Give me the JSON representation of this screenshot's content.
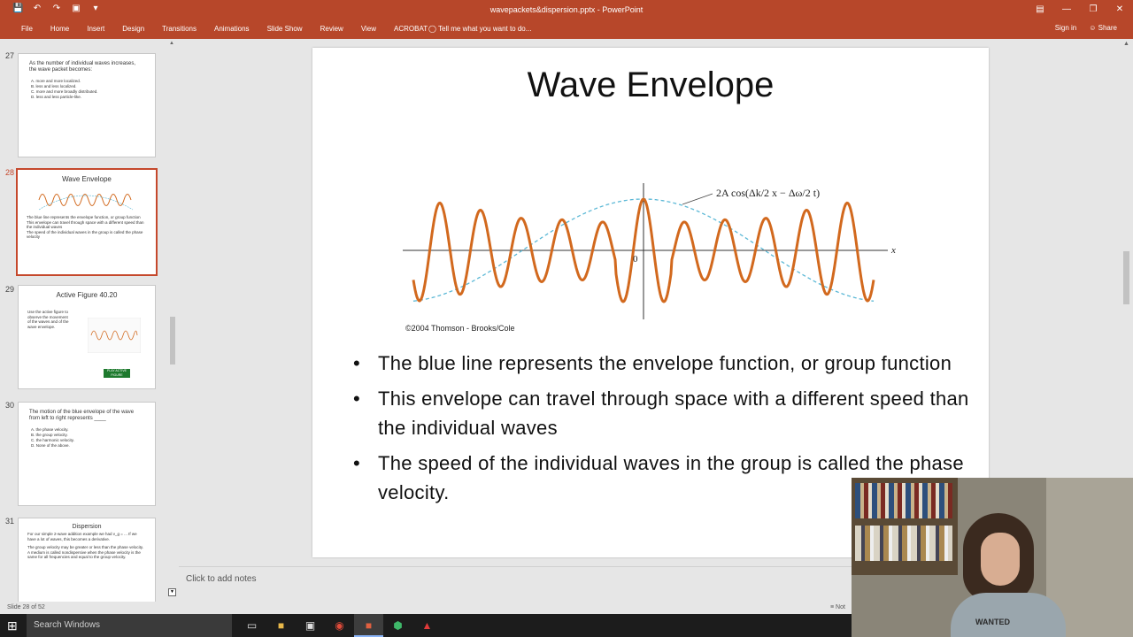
{
  "window": {
    "title": "wavepackets&dispersion.pptx - PowerPoint",
    "qat_icons": [
      "save-icon",
      "undo-icon",
      "redo-icon",
      "present-icon",
      "customize-icon"
    ],
    "controls": [
      "ribbon-display-icon",
      "minimize-icon",
      "restore-icon",
      "close-icon"
    ]
  },
  "ribbon": {
    "tabs": [
      "File",
      "Home",
      "Insert",
      "Design",
      "Transitions",
      "Animations",
      "Slide Show",
      "Review",
      "View",
      "ACROBAT"
    ],
    "tell_me": "Tell me what you want to do...",
    "sign_in": "Sign in",
    "share": "Share"
  },
  "thumbnails": [
    {
      "number": "27",
      "question": "As the number of individual waves increases, the wave packet becomes:",
      "options": [
        "A. more and more localized.",
        "B. less and less localized.",
        "C. more and more broadly distributed.",
        "D. less and less particle-like."
      ]
    },
    {
      "number": "28",
      "title": "Wave Envelope",
      "bullets": [
        "The blue line represents the envelope function, or group function",
        "This envelope can travel through space with a different speed than the individual waves",
        "The speed of the individual waves in the group is called the phase velocity"
      ]
    },
    {
      "number": "29",
      "title": "Active Figure 40.20",
      "bullets": [
        "Use the active figure to observe the movement of the waves and of the wave envelope."
      ],
      "button": "PLAY ACTIVE FIGURE"
    },
    {
      "number": "30",
      "question": "The motion of the blue envelope of the wave from left to right represents ____",
      "options": [
        "A. the phase velocity.",
        "B. the group velocity.",
        "C. the harmonic velocity.",
        "D. None of the above."
      ]
    },
    {
      "number": "31",
      "title": "Dispersion",
      "bullets": [
        "For our simple 2-wave addition example we had v_g = ... If we have a lot of waves, this becomes a derivative.",
        "The group velocity may be greater or less than the phase velocity. A medium is called nondispersive when the phase velocity is the same for all frequencies and equal to the group velocity."
      ]
    }
  ],
  "slide": {
    "title": "Wave Envelope",
    "figure": {
      "envelope_label": "2A cos(Δk/2 x − Δω/2 t)",
      "axis_x": "x",
      "origin": "0",
      "copyright": "©2004 Thomson - Brooks/Cole",
      "wave_color": "#d2691e",
      "envelope_color": "#5bb8d6"
    },
    "bullets": [
      "The blue line represents the envelope function, or group function",
      "This envelope can travel through space with a different speed than the individual waves",
      "The speed of the individual waves in the group is called the phase velocity."
    ]
  },
  "notes": {
    "placeholder": "Click to add notes"
  },
  "status": {
    "slide_counter": "Slide 28 of 52",
    "notes_toggle": "Not"
  },
  "taskbar": {
    "search_placeholder": "Search Windows",
    "apps": [
      "task-view-icon",
      "file-explorer-icon",
      "store-icon",
      "chrome-icon",
      "powerpoint-icon",
      "app-green-icon",
      "acrobat-icon"
    ]
  },
  "webcam": {
    "shirt_text": "WANTED"
  }
}
